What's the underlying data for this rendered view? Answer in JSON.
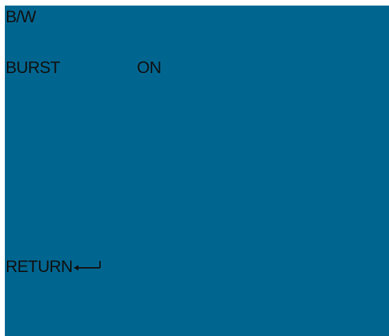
{
  "menu": {
    "title": "B/W",
    "items": [
      {
        "label": "BURST",
        "value": "ON"
      }
    ],
    "return_label": "RETURN",
    "return_icon": "enter-arrow-icon"
  },
  "colors": {
    "background": "#006690",
    "text": "#101010"
  }
}
